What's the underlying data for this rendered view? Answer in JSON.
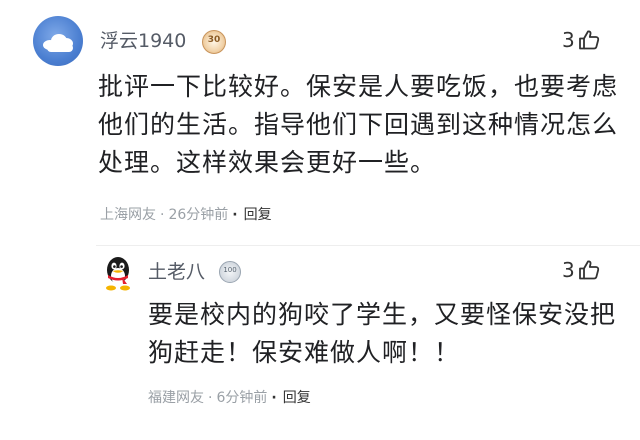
{
  "comments": [
    {
      "username": "浮云1940",
      "level_badge": "30",
      "like_count": "3",
      "text": "批评一下比较好。保安是人要吃饭，也要考虑他们的生活。指导他们下回遇到这种情况怎么处理。这样效果会更好一些。",
      "location": "上海网友",
      "time": "26分钟前",
      "reply_label": "回复"
    },
    {
      "username": "土老八",
      "level_badge": "100",
      "like_count": "3",
      "text": "要是校内的狗咬了学生，又要怪保安没把狗赶走！保安难做人啊！！",
      "location": "福建网友",
      "time": "6分钟前",
      "reply_label": "回复"
    }
  ],
  "meta_separator": "·",
  "icons": {
    "like": "thumbs-up-icon",
    "avatar1": "cloud-avatar",
    "avatar2": "qq-penguin-avatar"
  },
  "colors": {
    "username": "#555b66",
    "body_text": "#202124",
    "meta_text": "#9aa0a6"
  }
}
